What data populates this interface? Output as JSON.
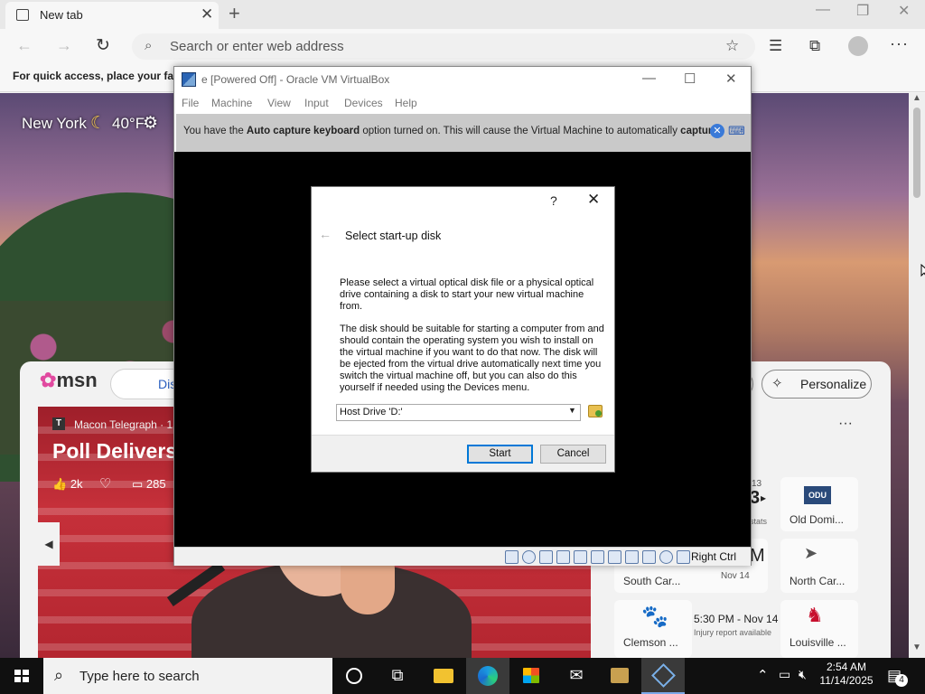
{
  "browser": {
    "tab_title": "New tab",
    "address_placeholder": "Search or enter web address",
    "favorites_bar_text": "For quick access, place your favo"
  },
  "weather": {
    "city": "New York",
    "temperature": "40°F"
  },
  "msn": {
    "logo_text": "msn",
    "discover_label": "Dis",
    "personalize_label": "Personalize"
  },
  "news": {
    "source": "Macon Telegraph · 1",
    "headline": "Poll Delivers",
    "likes": "2k",
    "comments": "285"
  },
  "sports": {
    "cards": [
      {
        "team": "Old Domi...",
        "logo": "ODU",
        "abbr": "ODU"
      },
      {
        "team": "South Car...",
        "time_partial": "M",
        "date": "Nov 14"
      },
      {
        "team": "North Car...",
        "logo": "hawk"
      },
      {
        "team": "Clemson ...",
        "logo": "paw"
      },
      {
        "time": "5:30 PM - Nov 14",
        "note": "Injury report available"
      },
      {
        "team": "Louisville ...",
        "logo": "cardinal"
      }
    ],
    "partial_numbers": "13",
    "partial_stats": "stats",
    "partial_big": "3"
  },
  "vbox": {
    "title": "e [Powered Off] - Oracle VM VirtualBox",
    "menu": [
      "File",
      "Machine",
      "View",
      "Input",
      "Devices",
      "Help"
    ],
    "banner_pre": "You have the ",
    "banner_bold1": "Auto capture keyboard",
    "banner_mid": " option turned on. This will cause the Virtual Machine to automatically ",
    "banner_bold2": "capture",
    "host_key": "Right Ctrl"
  },
  "dialog": {
    "help": "?",
    "heading": "Select start-up disk",
    "para1": "Please select a virtual optical disk file or a physical optical drive containing a disk to start your new virtual machine from.",
    "para2": "The disk should be suitable for starting a computer from and should contain the operating system you wish to install on the virtual machine if you want to do that now. The disk will be ejected from the virtual drive automatically next time you switch the virtual machine off, but you can also do this yourself if needed using the Devices menu.",
    "drive_value": "Host Drive 'D:'",
    "start_label": "Start",
    "cancel_label": "Cancel"
  },
  "taskbar": {
    "search_placeholder": "Type here to search",
    "time": "2:54 AM",
    "date": "11/14/2025",
    "notification_count": "4"
  },
  "colors": {
    "taskbar": "#101010",
    "accent": "#0078d7",
    "news_bg": "#b42630"
  }
}
